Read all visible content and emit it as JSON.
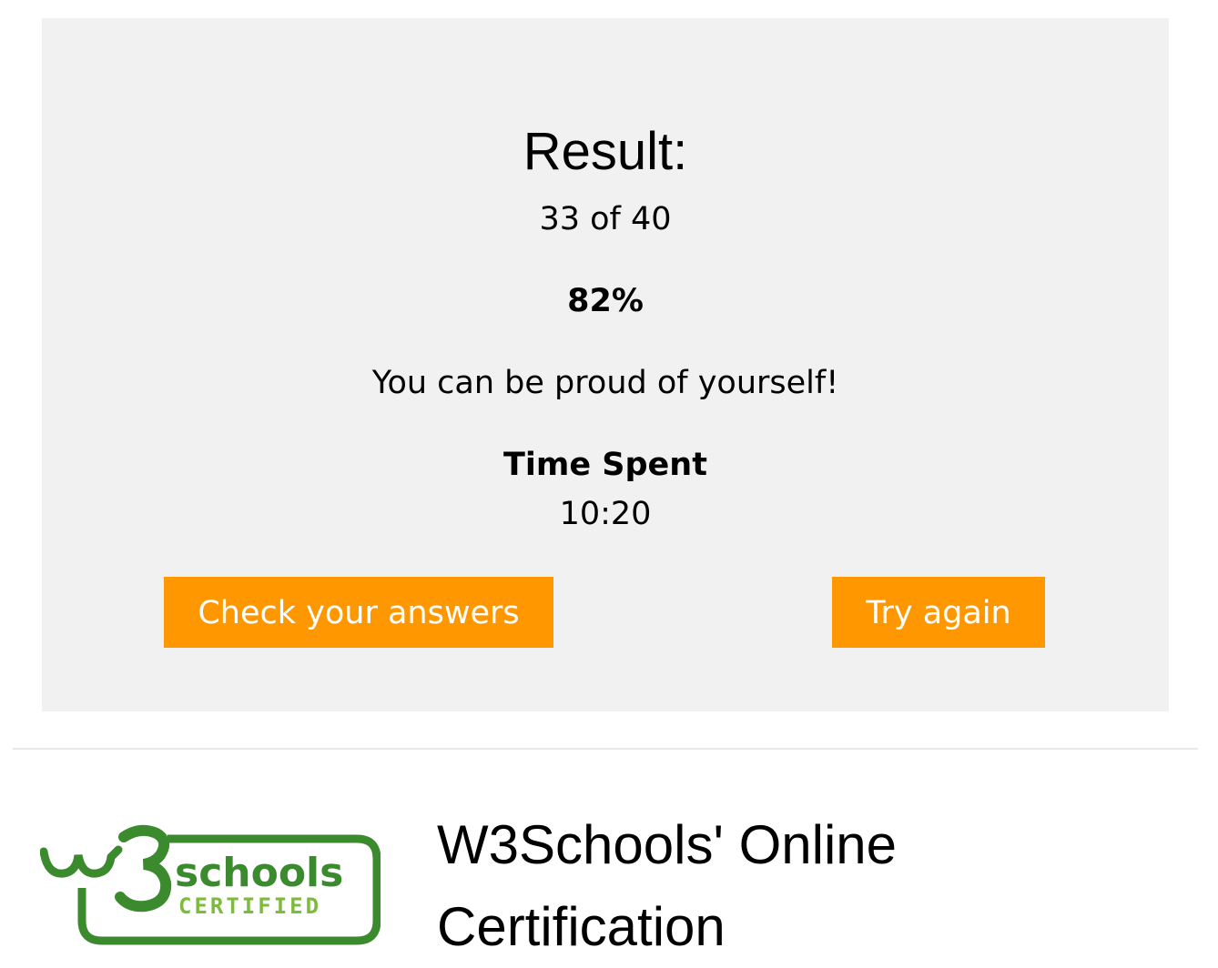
{
  "result": {
    "heading": "Result:",
    "score": "33 of 40",
    "percent": "82%",
    "message": "You can be proud of yourself!",
    "time_label": "Time Spent",
    "time_value": "10:20"
  },
  "actions": {
    "check_answers_label": "Check your answers",
    "try_again_label": "Try again"
  },
  "certification": {
    "logo_wordmark": "schools",
    "logo_tagline": "CERTIFIED",
    "title": "W3Schools' Online Certification"
  },
  "colors": {
    "button": "#ff9800",
    "panel": "#f1f1f1",
    "logo_green": "#3c8a2e",
    "logo_light_green": "#7dbb3c"
  }
}
